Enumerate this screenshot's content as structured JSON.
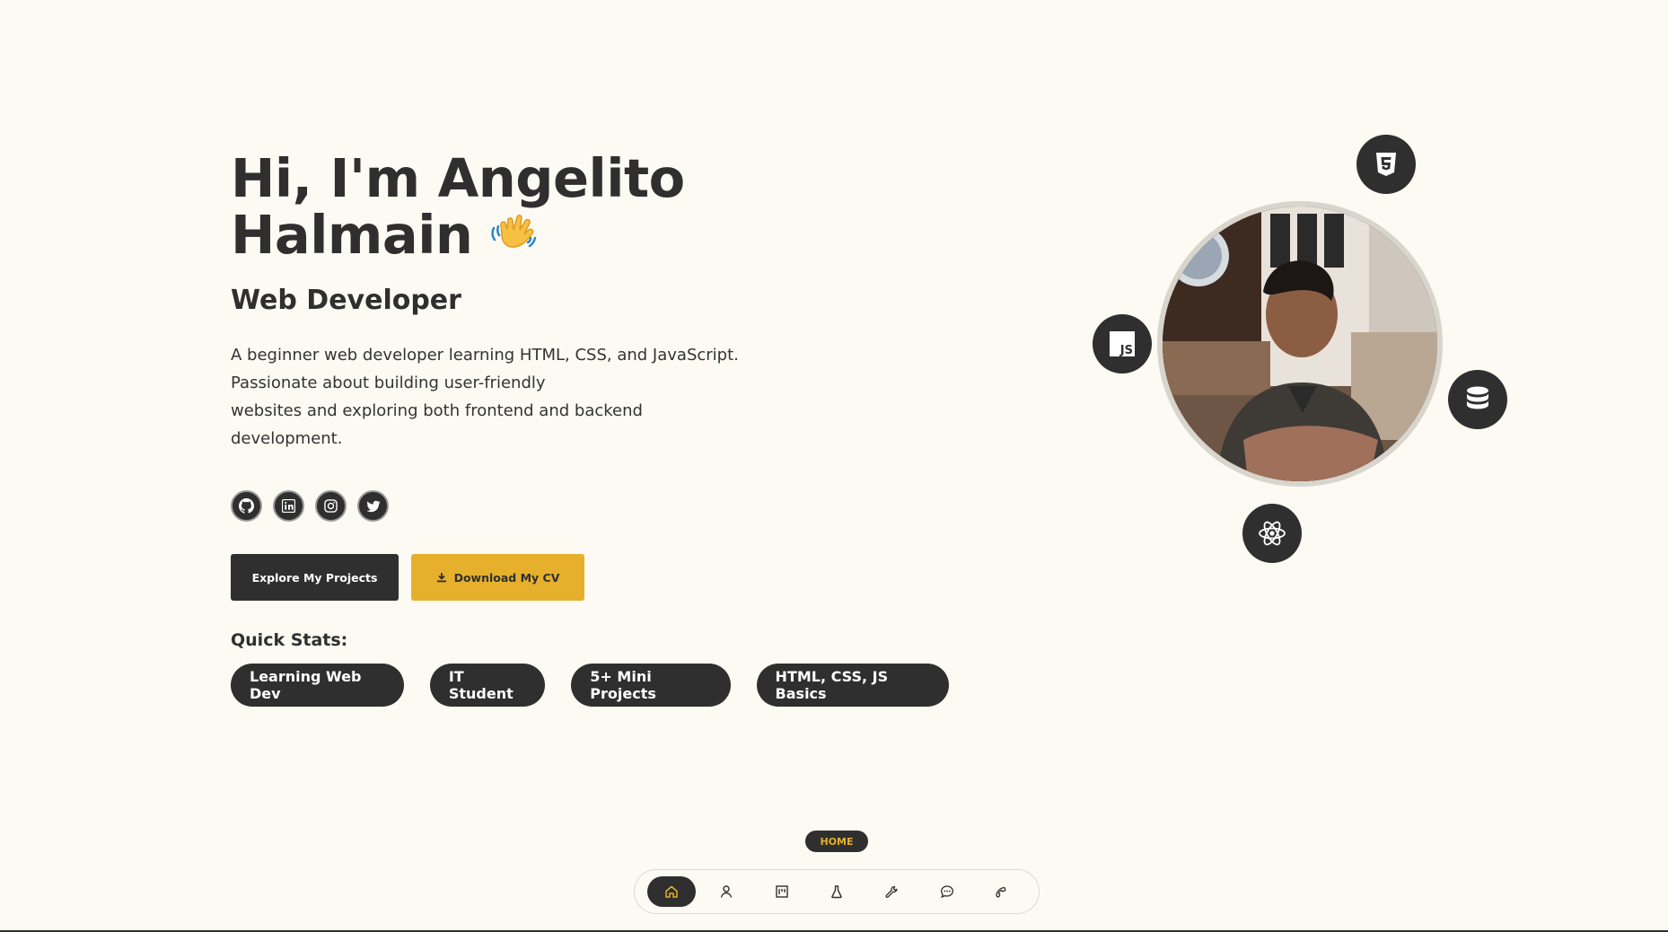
{
  "hero": {
    "title_line1": "Hi, I'm Angelito",
    "title_line2": "Halmain",
    "subtitle": "Web Developer",
    "description": [
      "A beginner web developer learning HTML, CSS, and JavaScript.",
      "Passionate about building user-friendly",
      "websites and exploring both frontend and backend",
      "development."
    ]
  },
  "socials": [
    {
      "icon": "github-icon"
    },
    {
      "icon": "linkedin-icon"
    },
    {
      "icon": "instagram-icon"
    },
    {
      "icon": "twitter-icon"
    }
  ],
  "cta": {
    "projects_label": "Explore My Projects",
    "cv_label": "Download My CV"
  },
  "stats": {
    "label": "Quick Stats:",
    "items": [
      "Learning Web Dev",
      "IT Student",
      "5+ Mini Projects",
      "HTML, CSS, JS Basics"
    ]
  },
  "orbit_icons": [
    "html5-icon",
    "javascript-icon",
    "database-icon",
    "react-icon"
  ],
  "nav": {
    "tooltip": "HOME",
    "items": [
      "home-icon",
      "user-icon",
      "projects-icon",
      "flask-icon",
      "tools-icon",
      "chat-icon",
      "phone-icon"
    ],
    "active": "home-icon"
  },
  "colors": {
    "background": "#fcfaf2",
    "dark": "#2f2f2f",
    "accent": "#e6b02d"
  }
}
